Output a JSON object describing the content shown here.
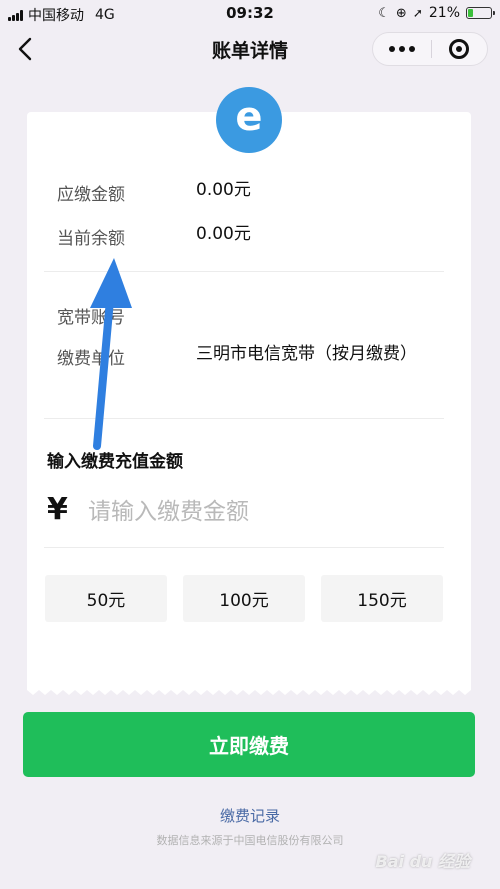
{
  "status_bar": {
    "carrier": "中国移动",
    "network": "4G",
    "time": "09:32",
    "battery_percent": "21%",
    "battery_level": 0.21
  },
  "nav": {
    "title": "账单详情"
  },
  "logo": {
    "letter": "e",
    "color": "#3b9ae1"
  },
  "bill": {
    "due_label": "应缴金额",
    "due_value": "0.00元",
    "balance_label": "当前余额",
    "balance_value": "0.00元",
    "account_label": "宽带账号",
    "unit_label": "缴费单位",
    "unit_value": "三明市电信宽带（按月缴费）"
  },
  "recharge": {
    "title": "输入缴费充值金额",
    "currency_symbol": "¥",
    "placeholder": "请输入缴费金额",
    "options": [
      "50元",
      "100元",
      "150元"
    ]
  },
  "actions": {
    "pay_label": "立即缴费",
    "pay_color": "#1fbe5a",
    "record_label": "缴费记录",
    "source_note": "数据信息来源于中国电信股份有限公司"
  },
  "annotation": {
    "arrow_color": "#2f7fe0"
  },
  "watermark": {
    "text": "Bai du 经验"
  }
}
